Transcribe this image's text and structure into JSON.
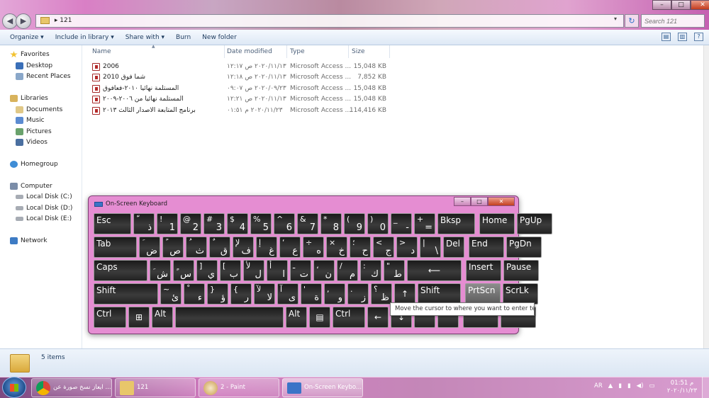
{
  "window": {
    "path": "121",
    "search_placeholder": "Search 121",
    "controls": {
      "minimize": "–",
      "maximize": "□",
      "close": "✕"
    }
  },
  "toolbar": {
    "organize": "Organize ▾",
    "include": "Include in library ▾",
    "share": "Share with ▾",
    "burn": "Burn",
    "newfolder": "New folder"
  },
  "nav": {
    "favorites": "Favorites",
    "desktop": "Desktop",
    "recent": "Recent Places",
    "libraries": "Libraries",
    "documents": "Documents",
    "music": "Music",
    "pictures": "Pictures",
    "videos": "Videos",
    "homegroup": "Homegroup",
    "computer": "Computer",
    "disk_c": "Local Disk (C:)",
    "disk_d": "Local Disk (D:)",
    "disk_e": "Local Disk (E:)",
    "network": "Network"
  },
  "columns": {
    "name": "Name",
    "date": "Date modified",
    "type": "Type",
    "size": "Size"
  },
  "files": [
    {
      "name": "2006",
      "date": "٢٠٢٠/١١/١٣ ص ١٢:١٧",
      "type": "Microsoft Access ...",
      "size": "15,048 KB"
    },
    {
      "name": "2010 شما فوق",
      "date": "٢٠٢٠/١١/١٣ ص ١٢:١٨",
      "type": "Microsoft Access ...",
      "size": "7,852 KB"
    },
    {
      "name": "المستلمة نهائيا ٢٠١٠-فعافوق",
      "date": "٢٠٢٠/٠٩/٢٣ ص ٠٩:٠٧",
      "type": "Microsoft Access ...",
      "size": "15,048 KB"
    },
    {
      "name": "المستلمة نهائيا من ٢٠٠٦-٢٠٠٩",
      "date": "٢٠٢٠/١١/١٣ ص ١٢:٢١",
      "type": "Microsoft Access ...",
      "size": "15,048 KB"
    },
    {
      "name": "برنامج المتابعة الاصدار الثالث ٢٠١٣",
      "date": "٢٠٢٠/١١/٢٣ م ٠١:٥١",
      "type": "Microsoft Access ...",
      "size": "114,416 KB"
    }
  ],
  "status": {
    "items": "5 items"
  },
  "osk": {
    "title": "On-Screen Keyboard",
    "controls": {
      "minimize": "–",
      "maximize": "□",
      "close": "✕"
    },
    "tooltip": "Move the cursor to where you want to enter text.",
    "rows": [
      [
        {
          "top": "Esc",
          "w": 50,
          "id": "esc"
        },
        {
          "top": "ّ",
          "l": "ذ",
          "w": 27,
          "id": "tilde"
        },
        {
          "top": "!",
          "l": "1",
          "w": 27,
          "id": "1"
        },
        {
          "top": "@",
          "l": "2",
          "w": 27,
          "id": "2"
        },
        {
          "top": "#",
          "l": "3",
          "w": 27,
          "id": "3"
        },
        {
          "top": "$",
          "l": "4",
          "w": 27,
          "id": "4"
        },
        {
          "top": "%",
          "l": "5",
          "w": 27,
          "id": "5"
        },
        {
          "top": "^",
          "l": "6",
          "w": 27,
          "id": "6"
        },
        {
          "top": "&",
          "l": "7",
          "w": 27,
          "id": "7"
        },
        {
          "top": "*",
          "l": "8",
          "w": 27,
          "id": "8"
        },
        {
          "top": "(",
          "l": "9",
          "w": 27,
          "id": "9"
        },
        {
          "top": ")",
          "l": "0",
          "w": 27,
          "id": "0"
        },
        {
          "top": "_",
          "l": "-",
          "w": 27,
          "id": "minus"
        },
        {
          "top": "+",
          "l": "=",
          "w": 27,
          "id": "equals"
        },
        {
          "top": "Bksp",
          "w": 50,
          "id": "bksp"
        },
        {
          "top": "Home",
          "w": 47,
          "id": "home",
          "gap": 3
        },
        {
          "top": "PgUp",
          "w": 47,
          "id": "pgup"
        }
      ],
      [
        {
          "top": "Tab",
          "w": 58,
          "id": "tab"
        },
        {
          "top": "َ",
          "l": "ض",
          "w": 27,
          "id": "q"
        },
        {
          "top": "ً",
          "l": "ص",
          "w": 27,
          "id": "w"
        },
        {
          "top": "ُ",
          "l": "ث",
          "w": 27,
          "id": "e"
        },
        {
          "top": "ٌ",
          "l": "ق",
          "w": 27,
          "id": "r"
        },
        {
          "top": "لإ",
          "l": "ف",
          "w": 27,
          "id": "t"
        },
        {
          "top": "إ",
          "l": "غ",
          "w": 27,
          "id": "y"
        },
        {
          "top": "‘",
          "l": "ع",
          "w": 27,
          "id": "u"
        },
        {
          "top": "÷",
          "l": "ه",
          "w": 27,
          "id": "i"
        },
        {
          "top": "×",
          "l": "خ",
          "w": 27,
          "id": "o"
        },
        {
          "top": "؛",
          "l": "ح",
          "w": 27,
          "id": "p"
        },
        {
          "top": "<",
          "l": "ج",
          "w": 27,
          "id": "lbracket"
        },
        {
          "top": ">",
          "l": "د",
          "w": 27,
          "id": "rbracket"
        },
        {
          "top": "|",
          "l": "\\",
          "w": 27,
          "id": "backslash"
        },
        {
          "top": "Del",
          "w": 27,
          "id": "del"
        },
        {
          "top": "End",
          "w": 47,
          "id": "end",
          "gap": 3
        },
        {
          "top": "PgDn",
          "w": 47,
          "id": "pgdn"
        }
      ],
      [
        {
          "top": "Caps",
          "w": 73,
          "id": "caps"
        },
        {
          "top": "ِ",
          "l": "ش",
          "w": 27,
          "id": "a"
        },
        {
          "top": "ٍ",
          "l": "س",
          "w": 27,
          "id": "s"
        },
        {
          "top": "]",
          "l": "ي",
          "w": 27,
          "id": "d"
        },
        {
          "top": "[",
          "l": "ب",
          "w": 27,
          "id": "f"
        },
        {
          "top": "لأ",
          "l": "ل",
          "w": 27,
          "id": "g"
        },
        {
          "top": "أ",
          "l": "ا",
          "w": 27,
          "id": "h"
        },
        {
          "top": "ـ",
          "l": "ت",
          "w": 27,
          "id": "j"
        },
        {
          "top": "،",
          "l": "ن",
          "w": 27,
          "id": "k"
        },
        {
          "top": "/",
          "l": "م",
          "w": 27,
          "id": "l"
        },
        {
          "top": ":",
          "l": "ك",
          "w": 27,
          "id": "semicolon"
        },
        {
          "top": "\"",
          "l": "ط",
          "w": 27,
          "id": "quote"
        },
        {
          "top": "⟵",
          "w": 74,
          "id": "enter"
        },
        {
          "top": "Insert",
          "w": 47,
          "id": "insert",
          "gap": 3
        },
        {
          "top": "Pause",
          "w": 47,
          "id": "pause"
        }
      ],
      [
        {
          "top": "Shift",
          "w": 88,
          "id": "lshift"
        },
        {
          "top": "~",
          "l": "ئ",
          "w": 27,
          "id": "z"
        },
        {
          "top": "ْ",
          "l": "ء",
          "w": 27,
          "id": "x"
        },
        {
          "top": "}",
          "l": "ؤ",
          "w": 27,
          "id": "c"
        },
        {
          "top": "{",
          "l": "ر",
          "w": 27,
          "id": "v"
        },
        {
          "top": "لآ",
          "l": "لا",
          "w": 27,
          "id": "b"
        },
        {
          "top": "آ",
          "l": "ى",
          "w": 27,
          "id": "n"
        },
        {
          "top": "'",
          "l": "ة",
          "w": 27,
          "id": "m"
        },
        {
          "top": ",",
          "l": "و",
          "w": 27,
          "id": "comma"
        },
        {
          "top": ".",
          "l": "ز",
          "w": 27,
          "id": "period"
        },
        {
          "top": "؟",
          "l": "ظ",
          "w": 27,
          "id": "slash"
        },
        {
          "top": "↑",
          "w": 27,
          "id": "up"
        },
        {
          "top": "Shift",
          "w": 58,
          "id": "rshift"
        },
        {
          "top": "PrtScn",
          "w": 47,
          "id": "prtscn",
          "gap": 3,
          "light": true
        },
        {
          "top": "ScrLk",
          "w": 47,
          "id": "scrlk"
        }
      ],
      [
        {
          "top": "Ctrl",
          "w": 43,
          "id": "lctrl"
        },
        {
          "top": "⊞",
          "w": 27,
          "id": "win"
        },
        {
          "top": "Alt",
          "w": 27,
          "id": "lalt"
        },
        {
          "top": "",
          "w": 150,
          "id": "space"
        },
        {
          "top": "Alt",
          "w": 27,
          "id": "ralt"
        },
        {
          "top": "▤",
          "w": 27,
          "id": "menu"
        },
        {
          "top": "Ctrl",
          "w": 43,
          "id": "rctrl"
        },
        {
          "top": "←",
          "w": 27,
          "id": "left"
        },
        {
          "top": "↓",
          "w": 27,
          "id": "down"
        },
        {
          "top": "",
          "w": 27,
          "id": "right"
        },
        {
          "top": "",
          "w": 27,
          "id": "fn"
        },
        {
          "top": "",
          "w": 47,
          "id": "options",
          "gap": 3
        },
        {
          "top": "",
          "w": 47,
          "id": "help"
        }
      ]
    ]
  },
  "taskbar": {
    "chrome": "ايعاز نسخ صورة عن ...",
    "explorer": "121",
    "paint": "2 - Paint",
    "osk": "On-Screen Keybo...",
    "lang": "AR",
    "time": "م 01:51",
    "date": "٢٠٢٠/١١/٢٣"
  }
}
